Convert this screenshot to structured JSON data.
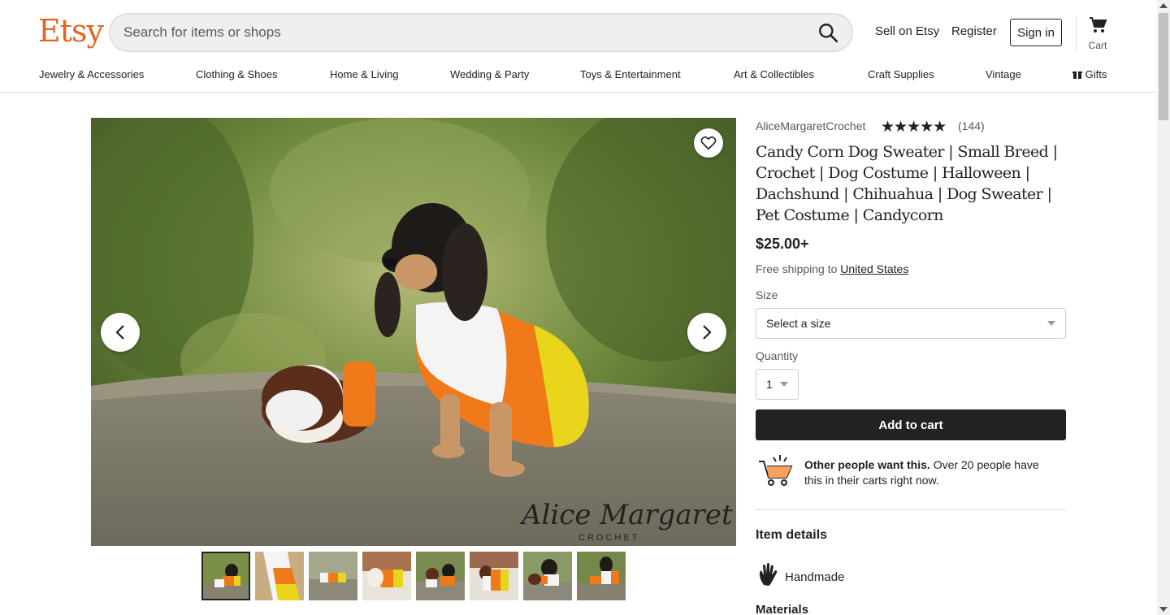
{
  "header": {
    "logo": "Etsy",
    "search_placeholder": "Search for items or shops",
    "sell": "Sell on Etsy",
    "register": "Register",
    "signin": "Sign in",
    "cart": "Cart"
  },
  "categories": [
    {
      "label": "Jewelry & Accessories"
    },
    {
      "label": "Clothing & Shoes"
    },
    {
      "label": "Home & Living"
    },
    {
      "label": "Wedding & Party"
    },
    {
      "label": "Toys & Entertainment"
    },
    {
      "label": "Art & Collectibles"
    },
    {
      "label": "Craft Supplies"
    },
    {
      "label": "Vintage"
    },
    {
      "label": "Gifts"
    }
  ],
  "listing": {
    "shop_name": "AliceMargaretCrochet",
    "stars": "★★★★★",
    "review_count": "(144)",
    "title": "Candy Corn Dog Sweater | Small Breed | Crochet | Dog Costume | Halloween | Dachshund | Chihuahua | Dog Sweater | Pet Costume | Candycorn",
    "price": "$25.00+",
    "shipping_prefix": "Free shipping to",
    "shipping_country": "United States",
    "size_label": "Size",
    "size_value": "Select a size",
    "quantity_label": "Quantity",
    "quantity_value": "1",
    "add_to_cart": "Add to cart",
    "demand_bold": "Other people want this.",
    "demand_rest": "Over 20 people have this in their carts right now.",
    "item_details": "Item details",
    "handmade": "Handmade",
    "materials": "Materials",
    "watermark": "Alice Margaret",
    "watermark_sub": "CROCHET"
  },
  "colors": {
    "brand": "#e1661f",
    "orange": "#f07a1a",
    "yellow": "#e8d51c"
  }
}
